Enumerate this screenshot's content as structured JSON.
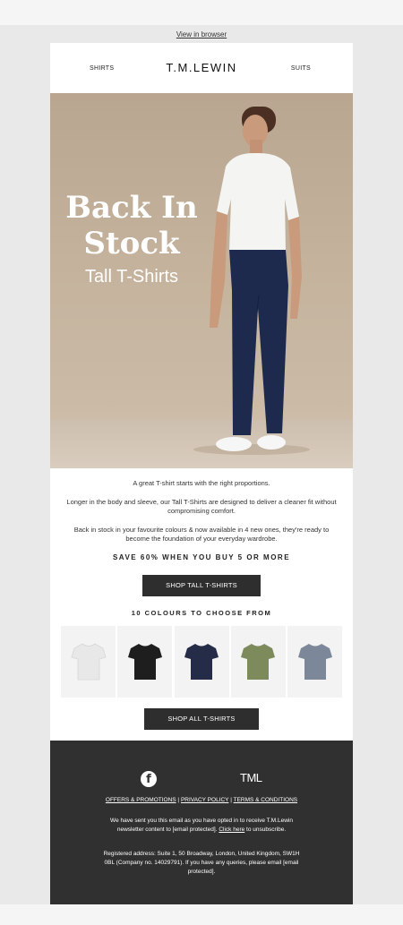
{
  "preheader": {
    "view_in_browser": "View in browser"
  },
  "header": {
    "nav_left": "SHIRTS",
    "logo": "T.M.LEWIN",
    "nav_right": "SUITS"
  },
  "hero": {
    "title_line1": "Back In",
    "title_line2": "Stock",
    "subtitle": "Tall T-Shirts"
  },
  "body": {
    "para1": "A great T-shirt starts with the right proportions.",
    "para2": "Longer in the body and sleeve, our Tall T-Shirts are designed to deliver a cleaner fit without compromising comfort.",
    "para3": "Back in stock in your favourite colours & now available in 4 new ones, they're ready to become the foundation of your everyday wardrobe.",
    "promo": "SAVE 60% WHEN YOU BUY 5 OR MORE",
    "cta_tall": "SHOP TALL T-SHIRTS",
    "colours_heading": "10 COLOURS TO CHOOSE FROM",
    "cta_all": "SHOP ALL T-SHIRTS"
  },
  "swatches": [
    {
      "color": "#e8e8e8",
      "icon": "white-tshirt-icon"
    },
    {
      "color": "#1e1e1e",
      "icon": "black-tshirt-icon"
    },
    {
      "color": "#252c48",
      "icon": "navy-tshirt-icon"
    },
    {
      "color": "#7d8a5c",
      "icon": "olive-tshirt-icon"
    },
    {
      "color": "#7c8899",
      "icon": "grey-blue-tshirt-icon"
    }
  ],
  "footer": {
    "facebook_icon": "facebook-icon",
    "brand_mark": "TML",
    "link_offers": "OFFERS & PROMOTIONS",
    "link_privacy": "PRIVACY POLICY",
    "link_terms": "TERMS & CONDITIONS",
    "separator": " | ",
    "optin_text": "We have sent you this email as you have opted in to receive T.M.Lewin newsletter content to [email protected].",
    "click_here": "Click here",
    "unsubscribe_text": "to unsubscribe.",
    "address": "Registered address: Suite 1, 50 Broadway, London, United Kingdom, SW1H 0BL (Company no. 14029791). If you have any queries, please email [email protected]."
  }
}
